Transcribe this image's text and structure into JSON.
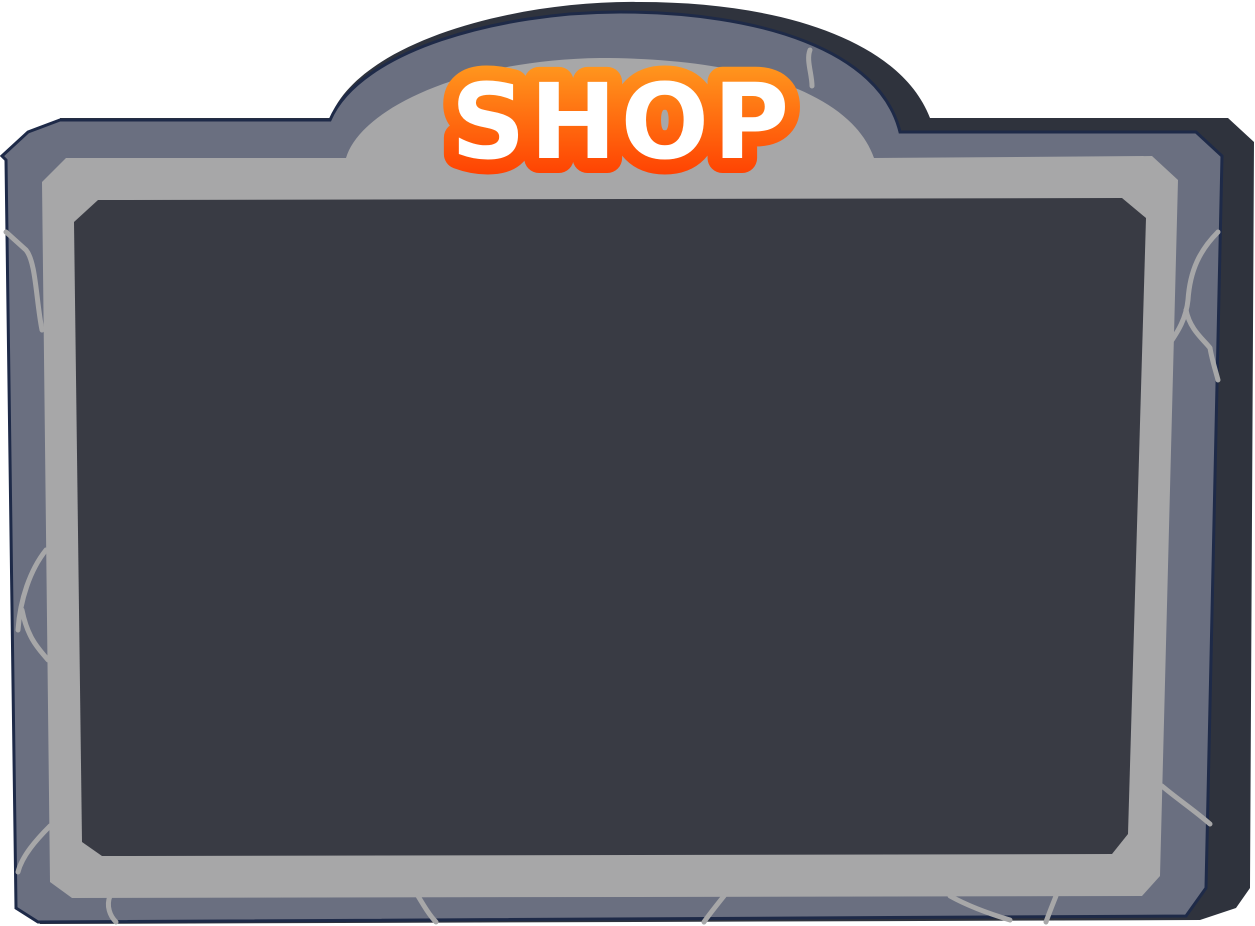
{
  "shop_panel": {
    "title": "SHOP",
    "colors": {
      "frame_outer": "#6a6f80",
      "frame_shadow": "#2f333d",
      "frame_outline": "#1e2a48",
      "frame_inner": "#a7a7a8",
      "content_bg": "#393b44",
      "title_fill": "#ffffff",
      "title_outline_top": "#ff9a1f",
      "title_outline_bottom": "#ff3c00"
    }
  }
}
